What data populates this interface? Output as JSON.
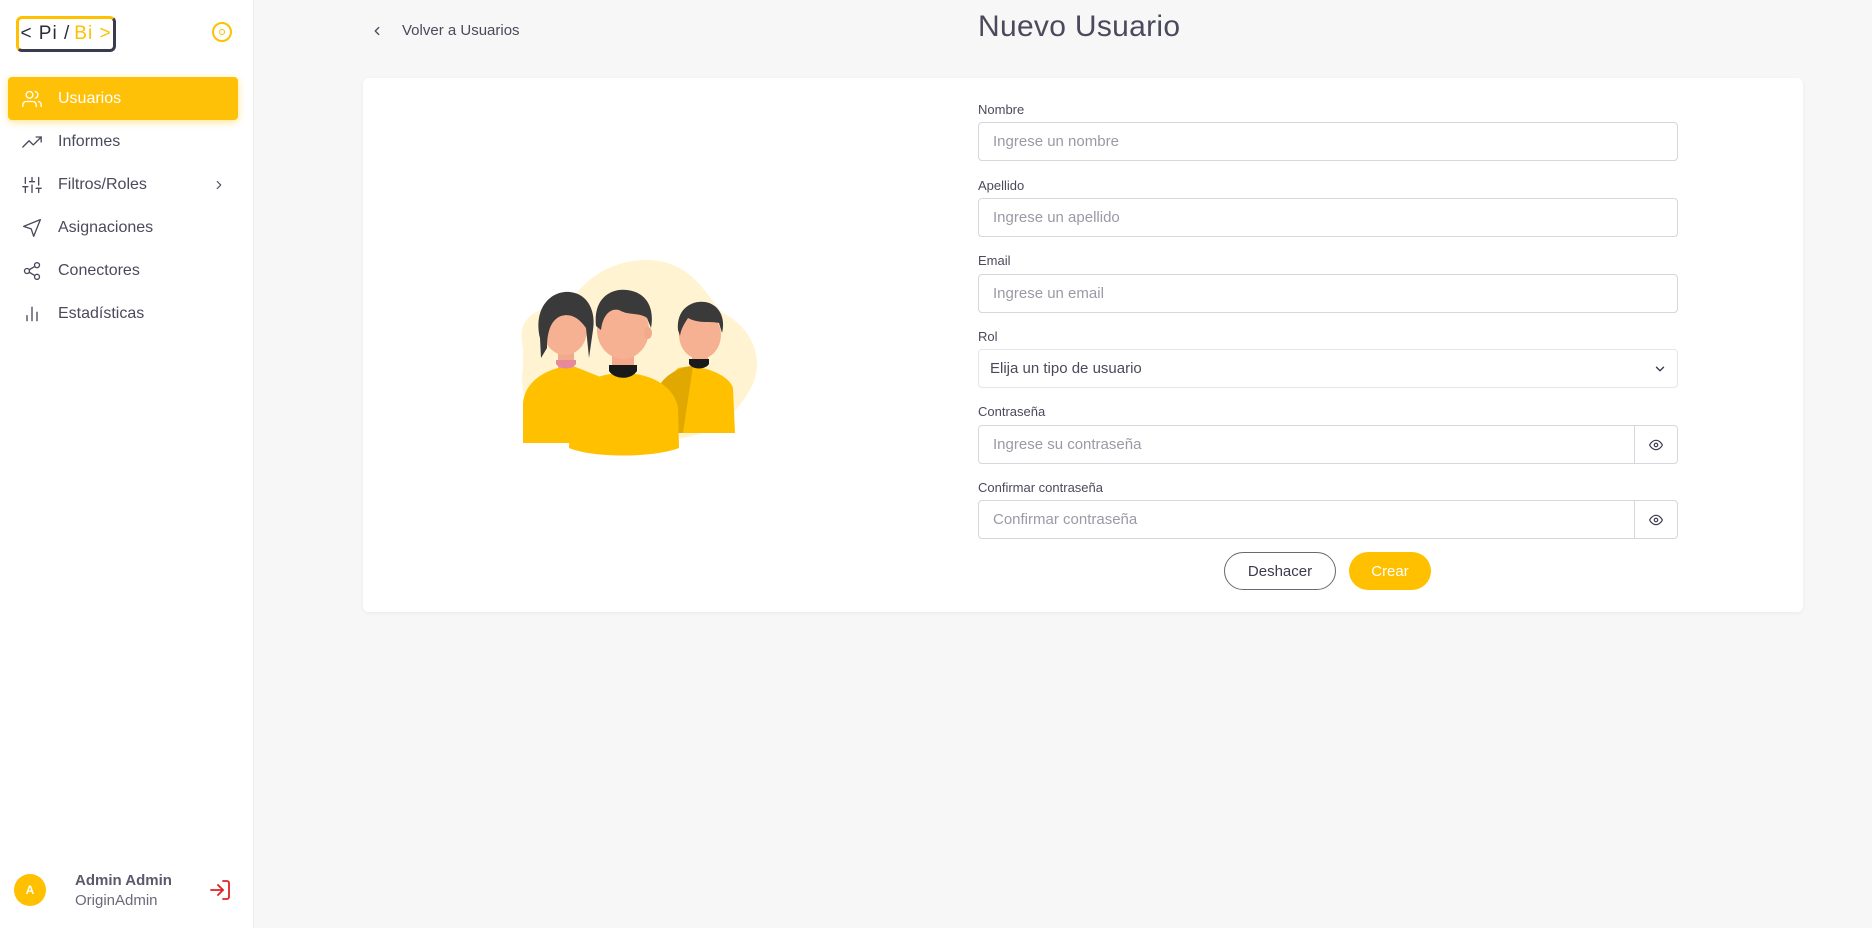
{
  "brand": {
    "logo_left": "< Pi /",
    "logo_right": "Bi >",
    "accent_color": "#ffc000"
  },
  "sidebar": {
    "items": [
      {
        "label": "Usuarios",
        "icon": "users-icon",
        "active": true
      },
      {
        "label": "Informes",
        "icon": "trending-up-icon",
        "active": false
      },
      {
        "label": "Filtros/Roles",
        "icon": "sliders-icon",
        "active": false,
        "has_submenu": true
      },
      {
        "label": "Asignaciones",
        "icon": "send-icon",
        "active": false
      },
      {
        "label": "Conectores",
        "icon": "share-icon",
        "active": false
      },
      {
        "label": "Estadísticas",
        "icon": "bar-chart-icon",
        "active": false
      }
    ]
  },
  "user": {
    "initial": "A",
    "name": "Admin Admin",
    "role": "OriginAdmin"
  },
  "header": {
    "back_label": "Volver a Usuarios",
    "title": "Nuevo Usuario"
  },
  "form": {
    "nombre": {
      "label": "Nombre",
      "placeholder": "Ingrese un nombre",
      "value": ""
    },
    "apellido": {
      "label": "Apellido",
      "placeholder": "Ingrese un apellido",
      "value": ""
    },
    "email": {
      "label": "Email",
      "placeholder": "Ingrese un email",
      "value": ""
    },
    "rol": {
      "label": "Rol",
      "selected": "Elija un tipo de usuario"
    },
    "password": {
      "label": "Contraseña",
      "placeholder": "Ingrese su contraseña",
      "value": ""
    },
    "confirm_password": {
      "label": "Confirmar contraseña",
      "placeholder": "Confirmar contraseña",
      "value": ""
    }
  },
  "actions": {
    "undo_label": "Deshacer",
    "create_label": "Crear"
  }
}
